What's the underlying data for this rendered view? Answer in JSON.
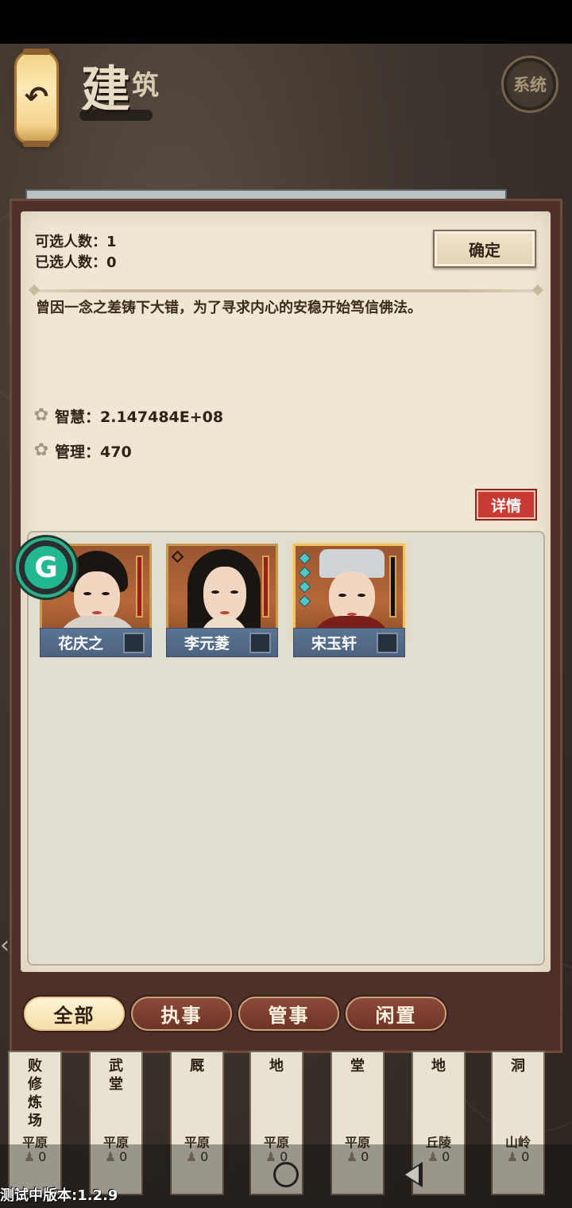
{
  "header": {
    "title_big": "建",
    "title_small": "筑",
    "back_icon": "↶",
    "system_label": "系统"
  },
  "panel": {
    "selectable_count": "可选人数：1",
    "selected_count": "已选人数：0",
    "confirm_label": "确定",
    "description": "曾因一念之差铸下大错，为了寻求内心的安稳开始笃信佛法。",
    "stats": [
      {
        "icon": "flower-icon",
        "text": "智慧：2.147484E+08"
      },
      {
        "icon": "flower-icon",
        "text": "管理：470"
      }
    ],
    "details_label": "详情"
  },
  "characters": [
    {
      "name": "花庆之",
      "bar": "red",
      "selected": false
    },
    {
      "name": "李元菱",
      "bar": "red",
      "selected": false
    },
    {
      "name": "宋玉轩",
      "bar": "dark",
      "selected": true
    }
  ],
  "floating_badge": "G",
  "filter_tabs": [
    {
      "label": "全部",
      "active": true
    },
    {
      "label": "执事",
      "active": false
    },
    {
      "label": "管事",
      "active": false
    },
    {
      "label": "闲置",
      "active": false
    }
  ],
  "buildings": [
    {
      "name": "败\n修\n炼\n场",
      "terrain": "平原",
      "count": "0"
    },
    {
      "name": "武\n堂",
      "terrain": "平原",
      "count": "0"
    },
    {
      "name": "厩",
      "terrain": "平原",
      "count": "0"
    },
    {
      "name": "地",
      "terrain": "平原",
      "count": "0"
    },
    {
      "name": "堂",
      "terrain": "平原",
      "count": "0"
    },
    {
      "name": "地",
      "terrain": "丘陵",
      "count": "0"
    },
    {
      "name": "洞",
      "terrain": "山岭",
      "count": "0"
    }
  ],
  "footer": {
    "version": "测试中版本:1.2.9"
  },
  "colors": {
    "accent_red": "#c83a33",
    "tab_brown": "#6e3428",
    "nameplate_blue": "#4b637f"
  }
}
